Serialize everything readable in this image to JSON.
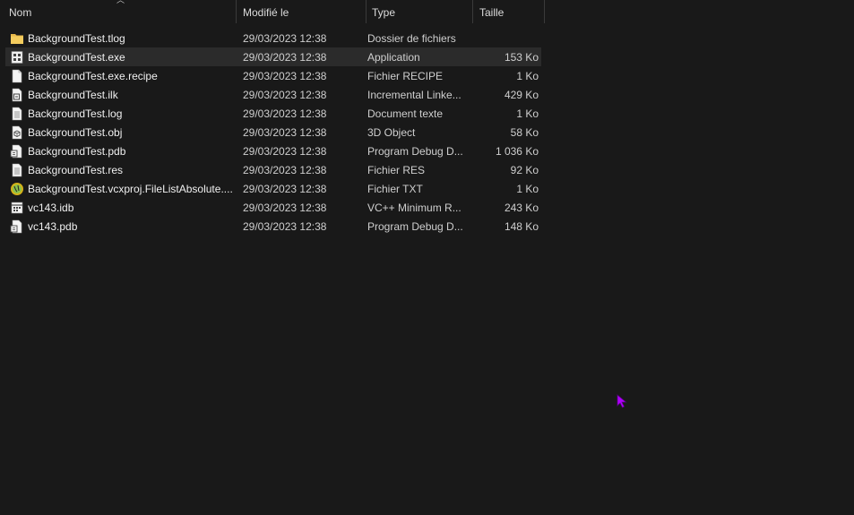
{
  "columns": {
    "name": "Nom",
    "modified": "Modifié le",
    "type": "Type",
    "size": "Taille"
  },
  "colors": {
    "background": "#191919",
    "selected_row": "#2b2b2b",
    "folder": "#e8b84a",
    "cursor": "#b000ff"
  },
  "files": [
    {
      "name": "BackgroundTest.tlog",
      "date": "29/03/2023 12:38",
      "type": "Dossier de fichiers",
      "size": "",
      "icon": "folder-icon"
    },
    {
      "name": "BackgroundTest.exe",
      "date": "29/03/2023 12:38",
      "type": "Application",
      "size": "153 Ko",
      "icon": "application-icon"
    },
    {
      "name": "BackgroundTest.exe.recipe",
      "date": "29/03/2023 12:38",
      "type": "Fichier RECIPE",
      "size": "1 Ko",
      "icon": "blank-file-icon"
    },
    {
      "name": "BackgroundTest.ilk",
      "date": "29/03/2023 12:38",
      "type": "Incremental Linke...",
      "size": "429 Ko",
      "icon": "linker-file-icon"
    },
    {
      "name": "BackgroundTest.log",
      "date": "29/03/2023 12:38",
      "type": "Document texte",
      "size": "1 Ko",
      "icon": "text-file-icon"
    },
    {
      "name": "BackgroundTest.obj",
      "date": "29/03/2023 12:38",
      "type": "3D Object",
      "size": "58 Ko",
      "icon": "3d-object-icon"
    },
    {
      "name": "BackgroundTest.pdb",
      "date": "29/03/2023 12:38",
      "type": "Program Debug D...",
      "size": "1 036 Ko",
      "icon": "debug-file-icon"
    },
    {
      "name": "BackgroundTest.res",
      "date": "29/03/2023 12:38",
      "type": "Fichier RES",
      "size": "92 Ko",
      "icon": "text-file-icon"
    },
    {
      "name": "BackgroundTest.vcxproj.FileListAbsolute....",
      "date": "29/03/2023 12:38",
      "type": "Fichier TXT",
      "size": "1 Ko",
      "icon": "notepad-plus-icon"
    },
    {
      "name": "vc143.idb",
      "date": "29/03/2023 12:38",
      "type": "VC++ Minimum R...",
      "size": "243 Ko",
      "icon": "idb-file-icon"
    },
    {
      "name": "vc143.pdb",
      "date": "29/03/2023 12:38",
      "type": "Program Debug D...",
      "size": "148 Ko",
      "icon": "debug-file-icon"
    }
  ],
  "selected_index": 1
}
